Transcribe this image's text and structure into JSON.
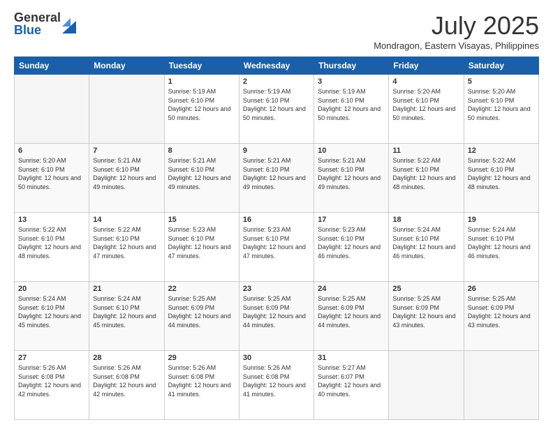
{
  "logo": {
    "general": "General",
    "blue": "Blue"
  },
  "header": {
    "month": "July 2025",
    "location": "Mondragon, Eastern Visayas, Philippines"
  },
  "weekdays": [
    "Sunday",
    "Monday",
    "Tuesday",
    "Wednesday",
    "Thursday",
    "Friday",
    "Saturday"
  ],
  "weeks": [
    [
      {
        "day": "",
        "info": ""
      },
      {
        "day": "",
        "info": ""
      },
      {
        "day": "1",
        "info": "Sunrise: 5:19 AM\nSunset: 6:10 PM\nDaylight: 12 hours and 50 minutes."
      },
      {
        "day": "2",
        "info": "Sunrise: 5:19 AM\nSunset: 6:10 PM\nDaylight: 12 hours and 50 minutes."
      },
      {
        "day": "3",
        "info": "Sunrise: 5:19 AM\nSunset: 6:10 PM\nDaylight: 12 hours and 50 minutes."
      },
      {
        "day": "4",
        "info": "Sunrise: 5:20 AM\nSunset: 6:10 PM\nDaylight: 12 hours and 50 minutes."
      },
      {
        "day": "5",
        "info": "Sunrise: 5:20 AM\nSunset: 6:10 PM\nDaylight: 12 hours and 50 minutes."
      }
    ],
    [
      {
        "day": "6",
        "info": "Sunrise: 5:20 AM\nSunset: 6:10 PM\nDaylight: 12 hours and 50 minutes."
      },
      {
        "day": "7",
        "info": "Sunrise: 5:21 AM\nSunset: 6:10 PM\nDaylight: 12 hours and 49 minutes."
      },
      {
        "day": "8",
        "info": "Sunrise: 5:21 AM\nSunset: 6:10 PM\nDaylight: 12 hours and 49 minutes."
      },
      {
        "day": "9",
        "info": "Sunrise: 5:21 AM\nSunset: 6:10 PM\nDaylight: 12 hours and 49 minutes."
      },
      {
        "day": "10",
        "info": "Sunrise: 5:21 AM\nSunset: 6:10 PM\nDaylight: 12 hours and 49 minutes."
      },
      {
        "day": "11",
        "info": "Sunrise: 5:22 AM\nSunset: 6:10 PM\nDaylight: 12 hours and 48 minutes."
      },
      {
        "day": "12",
        "info": "Sunrise: 5:22 AM\nSunset: 6:10 PM\nDaylight: 12 hours and 48 minutes."
      }
    ],
    [
      {
        "day": "13",
        "info": "Sunrise: 5:22 AM\nSunset: 6:10 PM\nDaylight: 12 hours and 48 minutes."
      },
      {
        "day": "14",
        "info": "Sunrise: 5:22 AM\nSunset: 6:10 PM\nDaylight: 12 hours and 47 minutes."
      },
      {
        "day": "15",
        "info": "Sunrise: 5:23 AM\nSunset: 6:10 PM\nDaylight: 12 hours and 47 minutes."
      },
      {
        "day": "16",
        "info": "Sunrise: 5:23 AM\nSunset: 6:10 PM\nDaylight: 12 hours and 47 minutes."
      },
      {
        "day": "17",
        "info": "Sunrise: 5:23 AM\nSunset: 6:10 PM\nDaylight: 12 hours and 46 minutes."
      },
      {
        "day": "18",
        "info": "Sunrise: 5:24 AM\nSunset: 6:10 PM\nDaylight: 12 hours and 46 minutes."
      },
      {
        "day": "19",
        "info": "Sunrise: 5:24 AM\nSunset: 6:10 PM\nDaylight: 12 hours and 46 minutes."
      }
    ],
    [
      {
        "day": "20",
        "info": "Sunrise: 5:24 AM\nSunset: 6:10 PM\nDaylight: 12 hours and 45 minutes."
      },
      {
        "day": "21",
        "info": "Sunrise: 5:24 AM\nSunset: 6:10 PM\nDaylight: 12 hours and 45 minutes."
      },
      {
        "day": "22",
        "info": "Sunrise: 5:25 AM\nSunset: 6:09 PM\nDaylight: 12 hours and 44 minutes."
      },
      {
        "day": "23",
        "info": "Sunrise: 5:25 AM\nSunset: 6:09 PM\nDaylight: 12 hours and 44 minutes."
      },
      {
        "day": "24",
        "info": "Sunrise: 5:25 AM\nSunset: 6:09 PM\nDaylight: 12 hours and 44 minutes."
      },
      {
        "day": "25",
        "info": "Sunrise: 5:25 AM\nSunset: 6:09 PM\nDaylight: 12 hours and 43 minutes."
      },
      {
        "day": "26",
        "info": "Sunrise: 5:25 AM\nSunset: 6:09 PM\nDaylight: 12 hours and 43 minutes."
      }
    ],
    [
      {
        "day": "27",
        "info": "Sunrise: 5:26 AM\nSunset: 6:08 PM\nDaylight: 12 hours and 42 minutes."
      },
      {
        "day": "28",
        "info": "Sunrise: 5:26 AM\nSunset: 6:08 PM\nDaylight: 12 hours and 42 minutes."
      },
      {
        "day": "29",
        "info": "Sunrise: 5:26 AM\nSunset: 6:08 PM\nDaylight: 12 hours and 41 minutes."
      },
      {
        "day": "30",
        "info": "Sunrise: 5:26 AM\nSunset: 6:08 PM\nDaylight: 12 hours and 41 minutes."
      },
      {
        "day": "31",
        "info": "Sunrise: 5:27 AM\nSunset: 6:07 PM\nDaylight: 12 hours and 40 minutes."
      },
      {
        "day": "",
        "info": ""
      },
      {
        "day": "",
        "info": ""
      }
    ]
  ]
}
